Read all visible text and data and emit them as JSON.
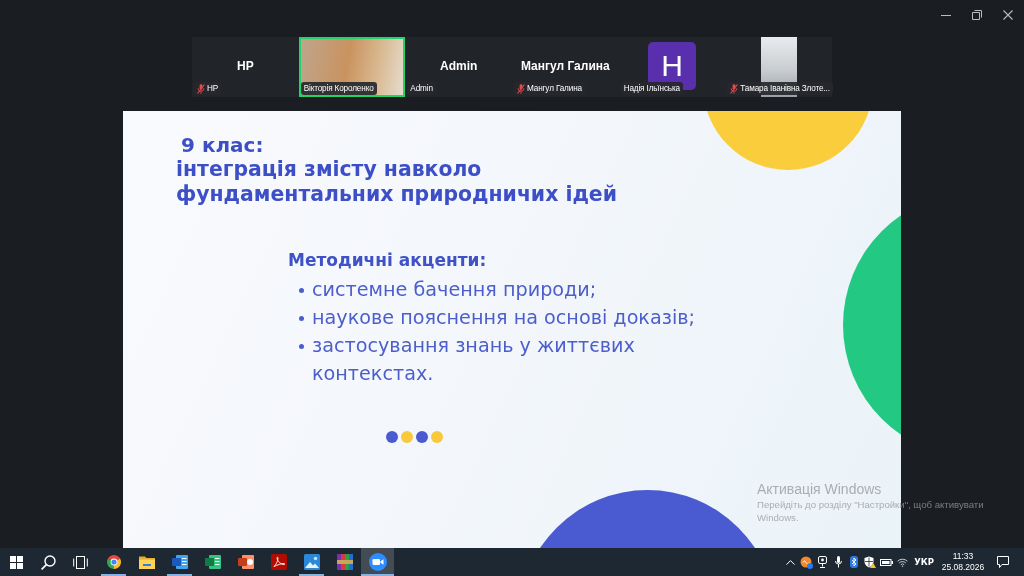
{
  "participants": [
    {
      "kind": "name",
      "center_name": "HP",
      "label": "HP",
      "muted": true,
      "speaking": false
    },
    {
      "kind": "video",
      "portrait": false,
      "label": "Вікторія Короленко",
      "muted": false,
      "speaking": true
    },
    {
      "kind": "name",
      "center_name": "Admin",
      "label": "Admin",
      "muted": false,
      "speaking": false
    },
    {
      "kind": "name",
      "center_name": "Мангул Галина",
      "label": "Мангул Галина",
      "muted": true,
      "speaking": false
    },
    {
      "kind": "avatar",
      "avatar": "H",
      "label": "Надія Ільїнська",
      "muted": false,
      "speaking": false
    },
    {
      "kind": "video",
      "portrait": true,
      "label": "Тамара Іванівна Злоте...",
      "muted": true,
      "speaking": false
    }
  ],
  "slide": {
    "grade": "9 клас:",
    "title": "інтеграція змісту навколо фундаментальних природничих ідей",
    "subheading": "Методичні акценти:",
    "bullets": [
      "системне бачення природи;",
      "наукове пояснення на основі доказів;",
      "застосування знань у життєвих контекстах."
    ],
    "dots": [
      {
        "color": "#4a5bd1"
      },
      {
        "color": "#f8c93a"
      },
      {
        "color": "#4a5bd1"
      },
      {
        "color": "#f8c93a"
      }
    ]
  },
  "activation_notice": {
    "title": "Активація Windows",
    "message": "Перейдіть до розділу \"Настройки\", щоб активувати Windows."
  },
  "taskbar": {
    "apps": [
      {
        "kind": "browser",
        "running": true,
        "selected": false
      },
      {
        "kind": "folder",
        "running": false,
        "selected": false
      },
      {
        "kind": "document",
        "running": true,
        "selected": false
      },
      {
        "kind": "spreadsheet",
        "running": false,
        "selected": false
      },
      {
        "kind": "presentation",
        "running": false,
        "selected": false
      },
      {
        "kind": "pdf",
        "running": false,
        "selected": false
      },
      {
        "kind": "photos",
        "running": true,
        "selected": false
      },
      {
        "kind": "archive",
        "running": false,
        "selected": false
      },
      {
        "kind": "video_call",
        "running": true,
        "selected": true
      }
    ],
    "tray": {
      "language": "УКР",
      "time": "11:33",
      "date": "25.08.2026"
    }
  }
}
